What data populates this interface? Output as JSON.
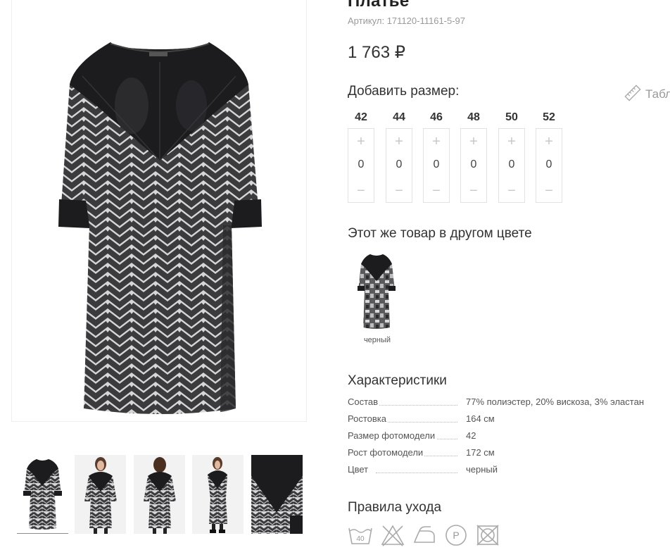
{
  "product": {
    "title": "Платье",
    "sku_label": "Артикул:",
    "sku": "171120-11161-5-97",
    "price": "1 763 ₽"
  },
  "sizes_block": {
    "title": "Добавить размер:",
    "size_table_label": "Табл",
    "plus_symbol": "+",
    "minus_symbol": "−",
    "sizes": [
      {
        "label": "42",
        "qty": "0"
      },
      {
        "label": "44",
        "qty": "0"
      },
      {
        "label": "46",
        "qty": "0"
      },
      {
        "label": "48",
        "qty": "0"
      },
      {
        "label": "50",
        "qty": "0"
      },
      {
        "label": "52",
        "qty": "0"
      }
    ]
  },
  "other_colors": {
    "title": "Этот же товар в другом цвете",
    "items": [
      {
        "name": "черный"
      }
    ]
  },
  "characteristics": {
    "title": "Характеристики",
    "rows": [
      {
        "key": "Состав",
        "value": "77% полиэстер, 20% вискоза, 3% эластан"
      },
      {
        "key": "Ростовка",
        "value": "164 см"
      },
      {
        "key": "Размер фотомодели",
        "value": "42"
      },
      {
        "key": "Рост фотомодели",
        "value": "172 см"
      },
      {
        "key": "Цвет",
        "value": "черный"
      }
    ]
  },
  "care": {
    "title": "Правила ухода",
    "wash_temp": "40",
    "dryclean_letter": "P",
    "icons": [
      "wash-40-icon",
      "no-bleach-icon",
      "iron-icon",
      "dry-clean-p-icon",
      "no-tumble-dry-icon"
    ]
  },
  "gallery": {
    "active_thumb": 0,
    "thumbs": [
      "thumb-dress-front",
      "thumb-model-front",
      "thumb-model-back",
      "thumb-model-side",
      "thumb-dress-detail"
    ]
  },
  "colors": {
    "accent": "#1bc3a3",
    "leather": "#1c1c1e",
    "knit_dark": "#3a3a3c",
    "knit_light": "#d4d4d6"
  }
}
